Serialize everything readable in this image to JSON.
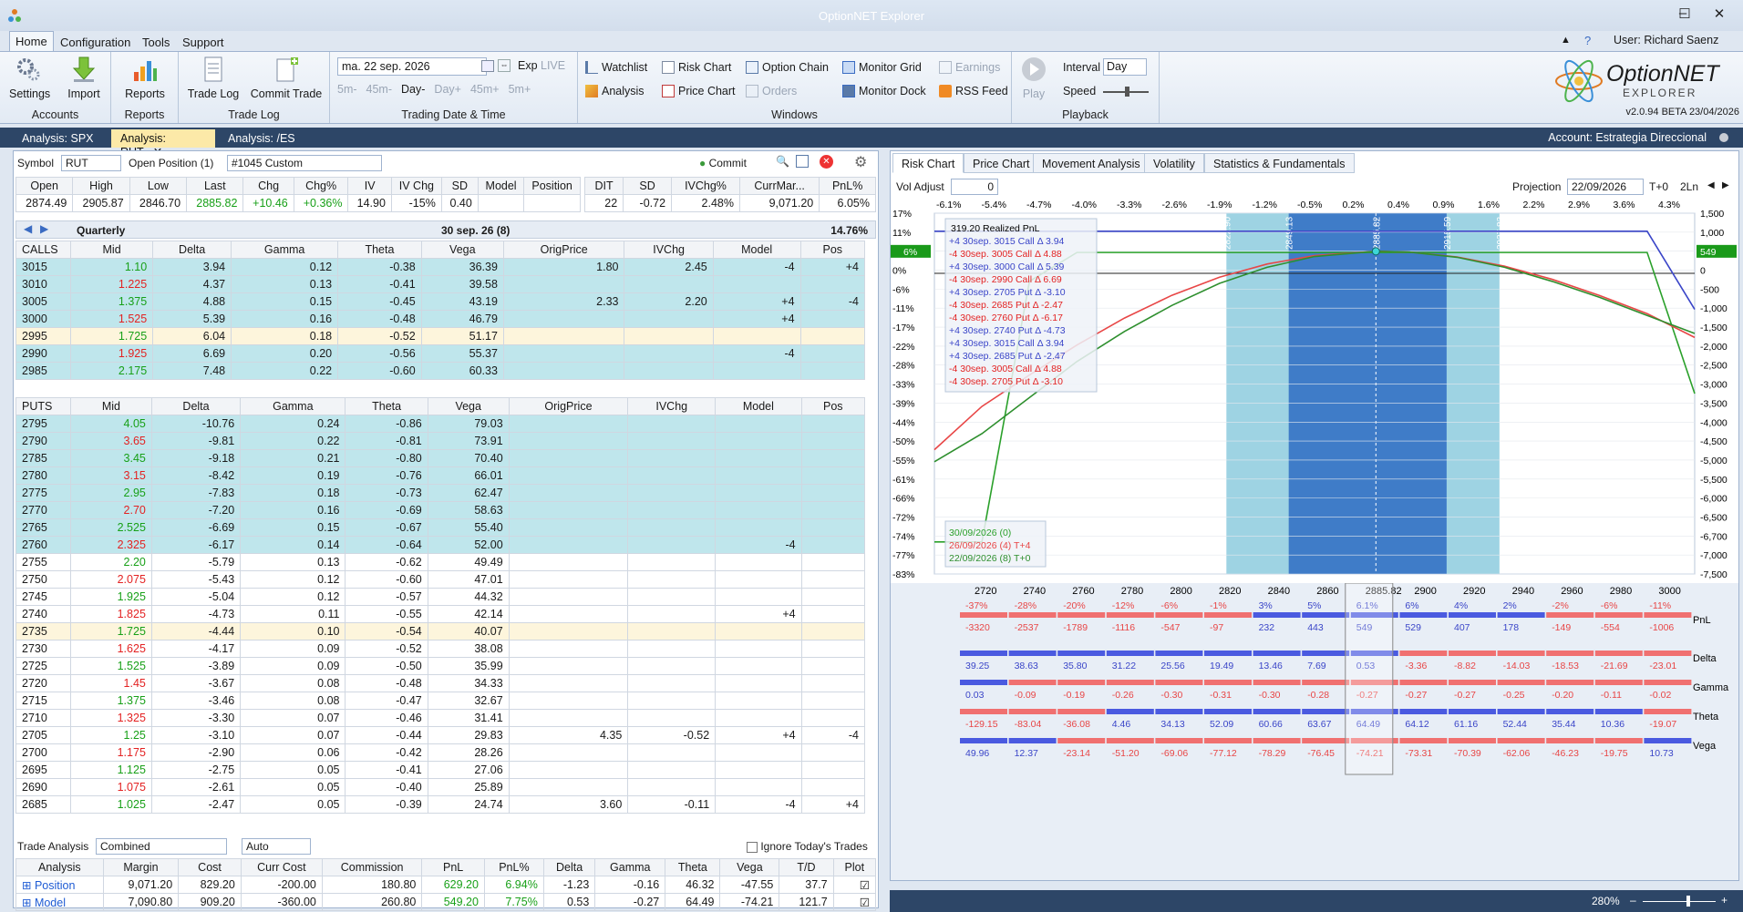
{
  "app": {
    "title": "OptionNET Explorer",
    "user": "User: Richard Saenz",
    "version": "v2.0.94 BETA 23/04/2026",
    "logo_main": "OptionNET",
    "logo_sub": "EXPLORER"
  },
  "menu": [
    "Home",
    "Configuration",
    "Tools",
    "Support"
  ],
  "ribbon": {
    "accounts": {
      "label": "Accounts",
      "settings": "Settings",
      "import": "Import"
    },
    "reports": {
      "label": "Reports",
      "reports": "Reports"
    },
    "tradelog": {
      "label": "Trade Log",
      "trade_log": "Trade Log",
      "commit_trade": "Commit Trade"
    },
    "trading": {
      "label": "Trading Date & Time",
      "date": "ma. 22 sep. 2026",
      "exp": "Exp",
      "live": "LIVE",
      "steps": [
        "5m-",
        "45m-",
        "Day-",
        "Day+",
        "45m+",
        "5m+"
      ]
    },
    "windows": {
      "label": "Windows",
      "watchlist": "Watchlist",
      "risk_chart": "Risk Chart",
      "option_chain": "Option Chain",
      "monitor_grid": "Monitor Grid",
      "earnings": "Earnings",
      "analysis": "Analysis",
      "price_chart": "Price Chart",
      "orders": "Orders",
      "monitor_dock": "Monitor Dock",
      "rss_feed": "RSS Feed"
    },
    "playback": {
      "label": "Playback",
      "play": "Play",
      "interval_label": "Interval",
      "interval": "Day",
      "speed_label": "Speed"
    }
  },
  "doc_tabs": [
    "Analysis: SPX",
    "Analysis: RUT",
    "Analysis: /ES"
  ],
  "account": "Account: Estrategia Direccional",
  "left": {
    "symbol_label": "Symbol",
    "symbol": "RUT",
    "open_pos_label": "Open Position (1)",
    "open_pos": "#1045 Custom",
    "commit": "Commit",
    "quote_headers": [
      "Open",
      "High",
      "Low",
      "Last",
      "Chg",
      "Chg%",
      "IV",
      "IV Chg",
      "SD",
      "Model",
      "Position"
    ],
    "quote_values": [
      "2874.49",
      "2905.87",
      "2846.70",
      "2885.82",
      "+10.46",
      "+0.36%",
      "14.90",
      "-15%",
      "0.40",
      "",
      ""
    ],
    "pos_headers": [
      "DIT",
      "SD",
      "IVChg%",
      "CurrMar...",
      "PnL%"
    ],
    "pos_values": [
      "22",
      "-0.72",
      "2.48%",
      "9,071.20",
      "6.05%"
    ],
    "quarter": {
      "label": "Quarterly",
      "exp": "30 sep. 26 (8)",
      "pct": "14.76%"
    },
    "chain_headers": [
      "Mid",
      "Delta",
      "Gamma",
      "Theta",
      "Vega",
      "OrigPrice",
      "IVChg",
      "Model",
      "Pos"
    ],
    "calls_label": "CALLS",
    "calls": [
      [
        "3015",
        "1.10",
        "3.94",
        "0.12",
        "-0.38",
        "36.39",
        "1.80",
        "2.45",
        "-4",
        "+4"
      ],
      [
        "3010",
        "1.225",
        "4.37",
        "0.13",
        "-0.41",
        "39.58",
        "",
        "",
        "",
        ""
      ],
      [
        "3005",
        "1.375",
        "4.88",
        "0.15",
        "-0.45",
        "43.19",
        "2.33",
        "2.20",
        "+4",
        "-4"
      ],
      [
        "3000",
        "1.525",
        "5.39",
        "0.16",
        "-0.48",
        "46.79",
        "",
        "",
        "+4",
        ""
      ],
      [
        "2995",
        "1.725",
        "6.04",
        "0.18",
        "-0.52",
        "51.17",
        "",
        "",
        "",
        ""
      ],
      [
        "2990",
        "1.925",
        "6.69",
        "0.20",
        "-0.56",
        "55.37",
        "",
        "",
        "-4",
        ""
      ],
      [
        "2985",
        "2.175",
        "7.48",
        "0.22",
        "-0.60",
        "60.33",
        "",
        "",
        "",
        ""
      ]
    ],
    "puts_label": "PUTS",
    "puts": [
      [
        "2795",
        "4.05",
        "-10.76",
        "0.24",
        "-0.86",
        "79.03",
        "",
        "",
        "",
        ""
      ],
      [
        "2790",
        "3.65",
        "-9.81",
        "0.22",
        "-0.81",
        "73.91",
        "",
        "",
        "",
        ""
      ],
      [
        "2785",
        "3.45",
        "-9.18",
        "0.21",
        "-0.80",
        "70.40",
        "",
        "",
        "",
        ""
      ],
      [
        "2780",
        "3.15",
        "-8.42",
        "0.19",
        "-0.76",
        "66.01",
        "",
        "",
        "",
        ""
      ],
      [
        "2775",
        "2.95",
        "-7.83",
        "0.18",
        "-0.73",
        "62.47",
        "",
        "",
        "",
        ""
      ],
      [
        "2770",
        "2.70",
        "-7.20",
        "0.16",
        "-0.69",
        "58.63",
        "",
        "",
        "",
        ""
      ],
      [
        "2765",
        "2.525",
        "-6.69",
        "0.15",
        "-0.67",
        "55.40",
        "",
        "",
        "",
        ""
      ],
      [
        "2760",
        "2.325",
        "-6.17",
        "0.14",
        "-0.64",
        "52.00",
        "",
        "",
        "-4",
        ""
      ],
      [
        "2755",
        "2.20",
        "-5.79",
        "0.13",
        "-0.62",
        "49.49",
        "",
        "",
        "",
        ""
      ],
      [
        "2750",
        "2.075",
        "-5.43",
        "0.12",
        "-0.60",
        "47.01",
        "",
        "",
        "",
        ""
      ],
      [
        "2745",
        "1.925",
        "-5.04",
        "0.12",
        "-0.57",
        "44.32",
        "",
        "",
        "",
        ""
      ],
      [
        "2740",
        "1.825",
        "-4.73",
        "0.11",
        "-0.55",
        "42.14",
        "",
        "",
        "+4",
        ""
      ],
      [
        "2735",
        "1.725",
        "-4.44",
        "0.10",
        "-0.54",
        "40.07",
        "",
        "",
        "",
        ""
      ],
      [
        "2730",
        "1.625",
        "-4.17",
        "0.09",
        "-0.52",
        "38.08",
        "",
        "",
        "",
        ""
      ],
      [
        "2725",
        "1.525",
        "-3.89",
        "0.09",
        "-0.50",
        "35.99",
        "",
        "",
        "",
        ""
      ],
      [
        "2720",
        "1.45",
        "-3.67",
        "0.08",
        "-0.48",
        "34.33",
        "",
        "",
        "",
        ""
      ],
      [
        "2715",
        "1.375",
        "-3.46",
        "0.08",
        "-0.47",
        "32.67",
        "",
        "",
        "",
        ""
      ],
      [
        "2710",
        "1.325",
        "-3.30",
        "0.07",
        "-0.46",
        "31.41",
        "",
        "",
        "",
        ""
      ],
      [
        "2705",
        "1.25",
        "-3.10",
        "0.07",
        "-0.44",
        "29.83",
        "4.35",
        "-0.52",
        "+4",
        "-4"
      ],
      [
        "2700",
        "1.175",
        "-2.90",
        "0.06",
        "-0.42",
        "28.26",
        "",
        "",
        "",
        ""
      ],
      [
        "2695",
        "1.125",
        "-2.75",
        "0.05",
        "-0.41",
        "27.06",
        "",
        "",
        "",
        ""
      ],
      [
        "2690",
        "1.075",
        "-2.61",
        "0.05",
        "-0.40",
        "25.89",
        "",
        "",
        "",
        ""
      ],
      [
        "2685",
        "1.025",
        "-2.47",
        "0.05",
        "-0.39",
        "24.74",
        "3.60",
        "-0.11",
        "-4",
        "+4"
      ]
    ],
    "trade_analysis": {
      "label": "Trade Analysis",
      "mode": "Combined",
      "auto": "Auto",
      "ignore": "Ignore Today's Trades",
      "headers": [
        "Analysis",
        "Margin",
        "Cost",
        "Curr Cost",
        "Commission",
        "PnL",
        "PnL%",
        "Delta",
        "Gamma",
        "Theta",
        "Vega",
        "T/D",
        "Plot"
      ],
      "rows": [
        [
          "Position",
          "9,071.20",
          "829.20",
          "-200.00",
          "180.80",
          "629.20",
          "6.94%",
          "-1.23",
          "-0.16",
          "46.32",
          "-47.55",
          "37.7",
          ""
        ],
        [
          "Model",
          "7,090.80",
          "909.20",
          "-360.00",
          "260.80",
          "549.20",
          "7.75%",
          "0.53",
          "-0.27",
          "64.49",
          "-74.21",
          "121.7",
          ""
        ]
      ]
    }
  },
  "right": {
    "tabs": [
      "Risk Chart",
      "Price Chart",
      "Movement Analysis",
      "Volatility",
      "Statistics & Fundamentals"
    ],
    "vol_adjust_label": "Vol Adjust",
    "vol_adjust": "0",
    "projection_label": "Projection",
    "projection": "22/09/2026",
    "t0": "T+0",
    "ln": "2Ln",
    "pct_top": [
      "-6.1%",
      "-5.4%",
      "-4.7%",
      "-4.0%",
      "-3.3%",
      "-2.6%",
      "-1.9%",
      "-1.2%",
      "-0.5%",
      "0.2%",
      "0.4%",
      "0.9%",
      "1.6%",
      "2.2%",
      "2.9%",
      "3.6%",
      "4.3%"
    ],
    "left_axis": [
      "17%",
      "11%",
      "6%",
      "0%",
      "-6%",
      "-11%",
      "-17%",
      "-22%",
      "-28%",
      "-33%",
      "-39%",
      "-44%",
      "-50%",
      "-55%",
      "-61%",
      "-66%",
      "-72%",
      "-74%",
      "-77%",
      "-83%"
    ],
    "right_axis": [
      "1,500",
      "1,000",
      "549",
      "0",
      "-500",
      "-1,000",
      "-1,500",
      "-2,000",
      "-2,500",
      "-3,000",
      "-3,500",
      "-4,000",
      "-4,500",
      "-5,000",
      "-5,500",
      "-6,000",
      "-6,500",
      "-6,700",
      "-7,000",
      "-7,500"
    ],
    "x_axis": [
      "2720",
      "2740",
      "2760",
      "2780",
      "2800",
      "2820",
      "2840",
      "2860",
      "2885.82",
      "2900",
      "2920",
      "2940",
      "2960",
      "2980",
      "3000"
    ],
    "band_labels": [
      "2822.90",
      "2849.13",
      "2885.82",
      "2915.59",
      "2937.83"
    ],
    "legend_title": "319.20 Realized PnL",
    "legend": [
      "+4 30sep. 3015 Call Δ  3.94",
      "-4 30sep. 3005 Call Δ  4.88",
      "+4 30sep. 3000 Call Δ  5.39",
      "-4 30sep. 2990 Call Δ  6.69",
      "+4 30sep. 2705 Put Δ  -3.10",
      "-4 30sep. 2685 Put Δ  -2.47",
      "-4 30sep. 2760 Put Δ  -6.17",
      "+4 30sep. 2740 Put Δ  -4.73",
      "+4 30sep. 3015 Call Δ  3.94",
      "+4 30sep. 2685 Put Δ  -2.47",
      "-4 30sep. 3005 Call Δ  4.88",
      "-4 30sep. 2705 Put Δ  -3.10"
    ],
    "date_legend": [
      "30/09/2026 (0)",
      "26/09/2026 (4) T+4",
      "22/09/2026 (8) T+0"
    ],
    "greek_rows": [
      "PnL",
      "Delta",
      "Gamma",
      "Theta",
      "Vega"
    ],
    "pnl_pct": [
      "-37%",
      "-28%",
      "-20%",
      "-12%",
      "-6%",
      "-1%",
      "3%",
      "5%",
      "6.1%",
      "6%",
      "4%",
      "2%",
      "-2%",
      "-6%",
      "-11%"
    ],
    "pnl_val": [
      "-3320",
      "-2537",
      "-1789",
      "-1116",
      "-547",
      "-97",
      "232",
      "443",
      "549",
      "529",
      "407",
      "178",
      "-149",
      "-554",
      "-1006"
    ],
    "delta": [
      "39.25",
      "38.63",
      "35.80",
      "31.22",
      "25.56",
      "19.49",
      "13.46",
      "7.69",
      "0.53",
      "-3.36",
      "-8.82",
      "-14.03",
      "-18.53",
      "-21.69",
      "-23.01"
    ],
    "gamma": [
      "0.03",
      "-0.09",
      "-0.19",
      "-0.26",
      "-0.30",
      "-0.31",
      "-0.30",
      "-0.28",
      "-0.27",
      "-0.27",
      "-0.27",
      "-0.25",
      "-0.20",
      "-0.11",
      "-0.02"
    ],
    "theta": [
      "-129.15",
      "-83.04",
      "-36.08",
      "4.46",
      "34.13",
      "52.09",
      "60.66",
      "63.67",
      "64.49",
      "64.12",
      "61.16",
      "52.44",
      "35.44",
      "10.36",
      "-19.07"
    ],
    "vega": [
      "49.96",
      "12.37",
      "-23.14",
      "-51.20",
      "-69.06",
      "-77.12",
      "-78.29",
      "-76.45",
      "-74.21",
      "-73.31",
      "-70.39",
      "-62.06",
      "-46.23",
      "-19.75",
      "10.73"
    ]
  },
  "status": {
    "zoom": "280%"
  },
  "chart_data": {
    "type": "line",
    "x": [
      2700,
      2720,
      2740,
      2760,
      2780,
      2800,
      2820,
      2840,
      2860,
      2885.82,
      2900,
      2920,
      2940,
      2960,
      2980,
      3000,
      3020
    ],
    "series": [
      {
        "name": "30/09/2026 (0)",
        "color": "#2aa02a",
        "values": [
          -6700,
          -6700,
          -200,
          520,
          520,
          520,
          520,
          520,
          520,
          520,
          520,
          520,
          520,
          520,
          520,
          520,
          -3000
        ]
      },
      {
        "name": "26/09/2026 (4) T+4",
        "color": "#e84646",
        "values": [
          -4400,
          -3320,
          -2537,
          -1789,
          -1116,
          -547,
          -97,
          232,
          443,
          549,
          529,
          407,
          178,
          -149,
          -554,
          -1006,
          -1600
        ]
      },
      {
        "name": "22/09/2026 (8) T+0",
        "color": "#2e8f2e",
        "values": [
          -4700,
          -4000,
          -3100,
          -2200,
          -1450,
          -800,
          -250,
          150,
          420,
          549,
          530,
          400,
          150,
          -200,
          -600,
          -1050,
          -1500
        ]
      },
      {
        "name": "position",
        "color": "#3a45c8",
        "values": [
          1050,
          1050,
          1050,
          1050,
          1050,
          1050,
          1050,
          1050,
          1050,
          1050,
          1050,
          1050,
          1050,
          1050,
          1050,
          1050,
          -900
        ]
      }
    ],
    "ylim": [
      -7500,
      1500
    ],
    "xlim": [
      2700,
      3020
    ]
  }
}
